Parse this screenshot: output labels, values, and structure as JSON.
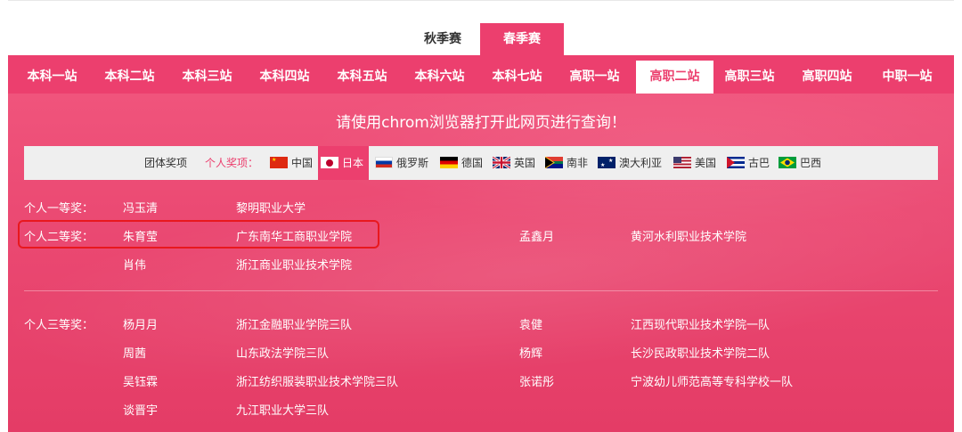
{
  "seasons": [
    {
      "label": "秋季赛",
      "active": false
    },
    {
      "label": "春季赛",
      "active": true
    }
  ],
  "stations": [
    "本科一站",
    "本科二站",
    "本科三站",
    "本科四站",
    "本科五站",
    "本科六站",
    "本科七站",
    "高职一站",
    "高职二站",
    "高职三站",
    "高职四站",
    "中职一站"
  ],
  "active_station": "高职二站",
  "notice": "请使用chrom浏览器打开此网页进行查询！",
  "award_bar": {
    "team_award": "团体奖项",
    "individual_award": "个人奖项：",
    "countries": [
      "中国",
      "日本",
      "俄罗斯",
      "德国",
      "英国",
      "南非",
      "澳大利亚",
      "美国",
      "古巴",
      "巴西"
    ],
    "selected_country": "日本"
  },
  "second_prize_section": {
    "first_label": "个人一等奖：",
    "second_label": "个人二等奖：",
    "rows": [
      {
        "name": "冯玉清",
        "school": "黎明职业大学",
        "name2": "",
        "school2": ""
      },
      {
        "name": "朱育莹",
        "school": "广东南华工商职业学院",
        "name2": "孟鑫月",
        "school2": "黄河水利职业技术学院"
      },
      {
        "name": "肖伟",
        "school": "浙江商业职业技术学院",
        "name2": "",
        "school2": ""
      }
    ]
  },
  "third_prize_section": {
    "label": "个人三等奖：",
    "rows": [
      {
        "name": "杨月月",
        "school": "浙江金融职业学院三队",
        "name2": "袁健",
        "school2": "江西现代职业技术学院一队"
      },
      {
        "name": "周茜",
        "school": "山东政法学院三队",
        "name2": "杨辉",
        "school2": "长沙民政职业技术学院二队"
      },
      {
        "name": "吴钰霖",
        "school": "浙江纺织服装职业技术学院三队",
        "name2": "张诺彤",
        "school2": "宁波幼儿师范高等专科学校一队"
      },
      {
        "name": "谈晋宇",
        "school": "九江职业大学三队",
        "name2": "",
        "school2": ""
      }
    ]
  },
  "colors": {
    "accent": "#ec3f6e",
    "highlight": "#e8181e"
  }
}
